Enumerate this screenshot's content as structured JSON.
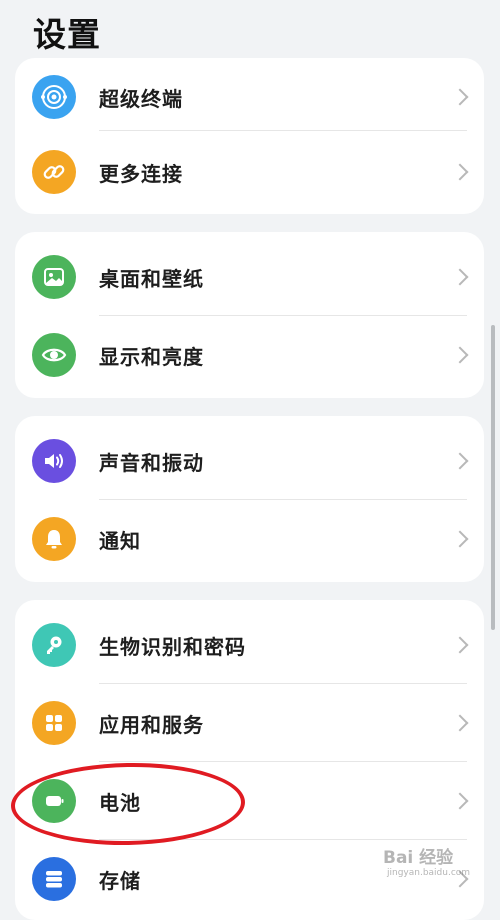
{
  "header": {
    "title": "设置"
  },
  "groups": [
    {
      "items": [
        {
          "label": "超级终端",
          "icon": "super-device-icon",
          "color": "#3aa3f0"
        },
        {
          "label": "更多连接",
          "icon": "link-icon",
          "color": "#f4a623"
        }
      ]
    },
    {
      "items": [
        {
          "label": "桌面和壁纸",
          "icon": "wallpaper-icon",
          "color": "#4cb45c"
        },
        {
          "label": "显示和亮度",
          "icon": "eye-icon",
          "color": "#4cb45c"
        }
      ]
    },
    {
      "items": [
        {
          "label": "声音和振动",
          "icon": "speaker-icon",
          "color": "#6a4fe0"
        },
        {
          "label": "通知",
          "icon": "bell-icon",
          "color": "#f4a623"
        }
      ]
    },
    {
      "items": [
        {
          "label": "生物识别和密码",
          "icon": "key-icon",
          "color": "#3fc7b5"
        },
        {
          "label": "应用和服务",
          "icon": "apps-grid-icon",
          "color": "#f4a623"
        },
        {
          "label": "电池",
          "icon": "battery-icon",
          "color": "#4cb45c"
        },
        {
          "label": "存储",
          "icon": "storage-icon",
          "color": "#2a6fe0"
        }
      ]
    }
  ],
  "watermark": {
    "main": "Bai 经验",
    "sub": "jingyan.baidu.com"
  }
}
